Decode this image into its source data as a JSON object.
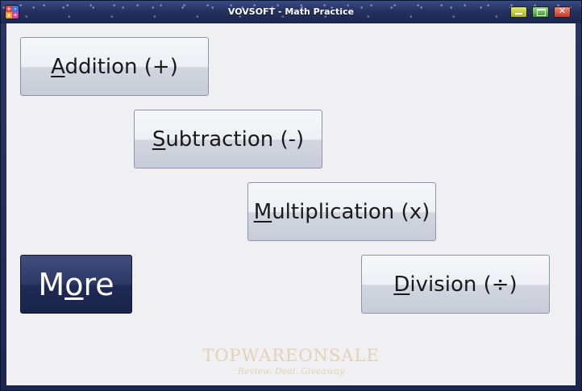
{
  "window": {
    "title": "VOVSOFT - Math Practice",
    "app_icon": {
      "glyphs": [
        "+",
        "-",
        "x",
        "÷"
      ],
      "name": "math-practice-icon"
    },
    "controls": {
      "minimize": "minimize-icon",
      "maximize": "maximize-icon",
      "close": "close-icon"
    }
  },
  "buttons": {
    "addition": {
      "mnemonic": "A",
      "rest": "ddition (+)"
    },
    "subtraction": {
      "mnemonic": "S",
      "rest": "ubtraction (-)"
    },
    "multiplication": {
      "mnemonic": "M",
      "rest": "ultiplication (x)"
    },
    "division": {
      "mnemonic": "D",
      "rest": "ivision (÷)"
    },
    "more": {
      "pre": "M",
      "mnemonic": "o",
      "rest": "re"
    }
  },
  "watermark": {
    "main": "TOPWAREONSALE",
    "tagline": "Review. Deal. Giveaway"
  },
  "colors": {
    "titlebar": "#25325f",
    "client_bg": "#f0f0f3",
    "more_button": "#2c3866"
  }
}
